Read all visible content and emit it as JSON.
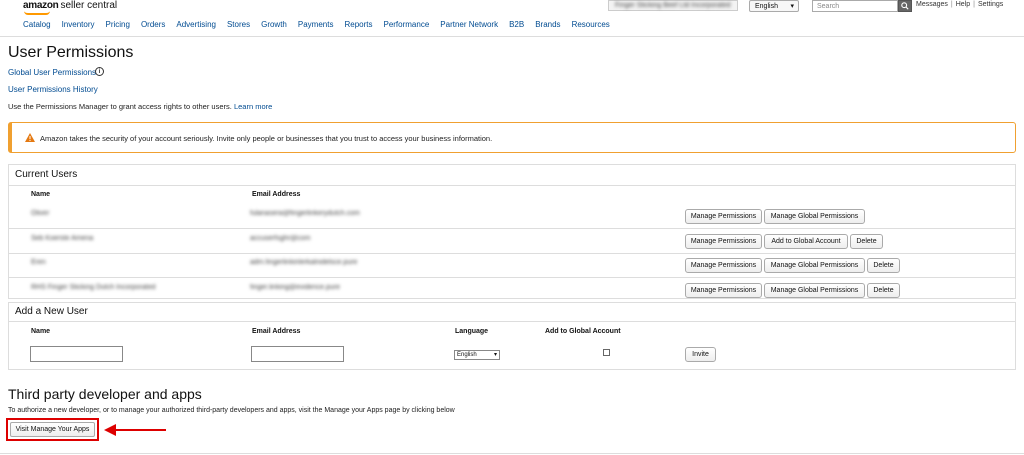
{
  "header": {
    "logo_text_bold": "amazon",
    "logo_text_light": "seller central",
    "store_name": "Finger Sticking Beef Ltd Incorporated",
    "language": "English",
    "search_placeholder": "Search",
    "links": [
      "Messages",
      "Help",
      "Settings"
    ],
    "brand_color": "#ff9900"
  },
  "nav": [
    "Catalog",
    "Inventory",
    "Pricing",
    "Orders",
    "Advertising",
    "Stores",
    "Growth",
    "Payments",
    "Reports",
    "Performance",
    "Partner Network",
    "B2B",
    "Brands",
    "Resources"
  ],
  "page": {
    "title": "User Permissions",
    "global_link": "Global User Permissions",
    "history_link": "User Permissions History",
    "intro": "Use the Permissions Manager to grant access rights to other users.",
    "learn_more": "Learn more",
    "alert": "Amazon takes the security of your account seriously. Invite only people or businesses that you trust to access your business information."
  },
  "current_users": {
    "title": "Current Users",
    "headers": [
      "Name",
      "Email Address"
    ],
    "rows": [
      {
        "name": "Oliver",
        "email": "fulanasera@fingerlinkerydutch.com",
        "actions": [
          "Manage Permissions",
          "Manage Global Permissions"
        ]
      },
      {
        "name": "Seb Koerste Amena",
        "email": "accuserfsghr@com",
        "actions": [
          "Manage Permissions",
          "Add to Global Account",
          "Delete"
        ]
      },
      {
        "name": "Eren",
        "email": "adm.fingerlinkinlerkalnidelsce.pure",
        "actions": [
          "Manage Permissions",
          "Manage Global Permissions",
          "Delete"
        ]
      },
      {
        "name": "RHS Finger Sticking Dutch Incorporated",
        "email": "finger.linking@evidence.pure",
        "actions": [
          "Manage Permissions",
          "Manage Global Permissions",
          "Delete"
        ]
      }
    ]
  },
  "add_user": {
    "title": "Add a New User",
    "headers": [
      "Name",
      "Email Address",
      "Language",
      "Add to Global Account"
    ],
    "language_value": "English",
    "invite_label": "Invite"
  },
  "third_party": {
    "title": "Third party developer and apps",
    "description": "To authorize a new developer, or to manage your authorized third-party developers and apps, visit the Manage your Apps page by clicking below",
    "button_label": "Visit Manage Your Apps",
    "highlight_color": "#dd0000"
  }
}
